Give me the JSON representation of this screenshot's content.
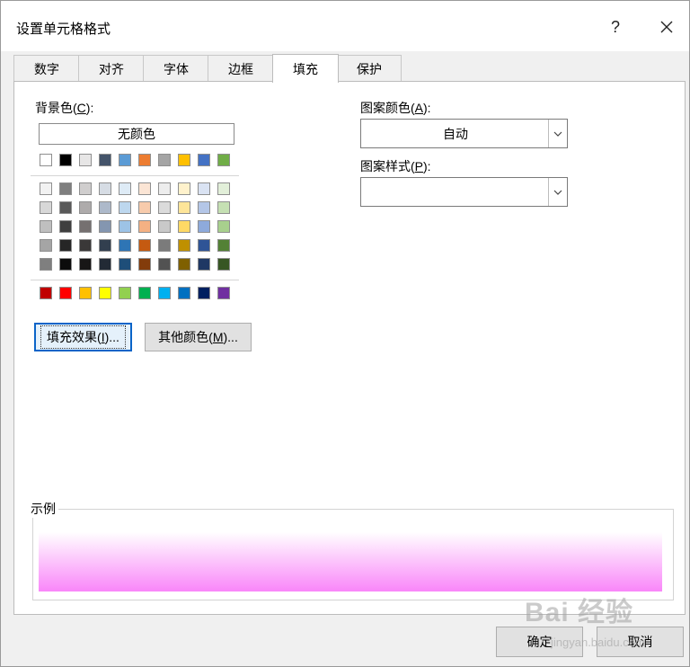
{
  "title": "设置单元格格式",
  "titlebar": {
    "help": "?",
    "close": "✕"
  },
  "tabs": [
    "数字",
    "对齐",
    "字体",
    "边框",
    "填充",
    "保护"
  ],
  "active_tab": "填充",
  "background_color": {
    "label_pre": "背景色(",
    "label_key": "C",
    "label_post": "):",
    "no_color": "无颜色",
    "theme_row": [
      "#ffffff",
      "#000000",
      "#e7e6e6",
      "#44546a",
      "#5b9bd5",
      "#ed7d31",
      "#a5a5a5",
      "#ffc000",
      "#4472c4",
      "#70ad47"
    ],
    "tints": [
      [
        "#f2f2f2",
        "#7f7f7f",
        "#d0cece",
        "#d6dce4",
        "#deebf6",
        "#fbe5d5",
        "#ededed",
        "#fff2cc",
        "#dae3f3",
        "#e2efd9"
      ],
      [
        "#d8d8d8",
        "#595959",
        "#aeabab",
        "#adb9ca",
        "#bdd7ee",
        "#f7cbac",
        "#dbdbdb",
        "#fee599",
        "#b4c6e7",
        "#c5e0b3"
      ],
      [
        "#bfbfbf",
        "#3f3f3f",
        "#757070",
        "#8496b0",
        "#9dc3e6",
        "#f4b183",
        "#c9c9c9",
        "#ffd965",
        "#8eaadb",
        "#a8d08d"
      ],
      [
        "#a5a5a5",
        "#262626",
        "#3a3838",
        "#323f4f",
        "#2e75b5",
        "#c55a11",
        "#7b7b7b",
        "#bf9000",
        "#2f5496",
        "#538135"
      ],
      [
        "#7f7f7f",
        "#0c0c0c",
        "#171616",
        "#222a35",
        "#1e4e79",
        "#833c0b",
        "#525252",
        "#7f6000",
        "#1f3864",
        "#375623"
      ]
    ],
    "standard_row": [
      "#c00000",
      "#ff0000",
      "#ffc000",
      "#ffff00",
      "#92d050",
      "#00b050",
      "#00b0f0",
      "#0070c0",
      "#002060",
      "#7030a0"
    ]
  },
  "buttons": {
    "fill_effects": {
      "pre": "填充效果(",
      "key": "I",
      "post": ")..."
    },
    "more_colors": {
      "pre": "其他颜色(",
      "key": "M",
      "post": ")..."
    }
  },
  "pattern_color": {
    "label_pre": "图案颜色(",
    "label_key": "A",
    "label_post": "):",
    "value": "自动"
  },
  "pattern_style": {
    "label_pre": "图案样式(",
    "label_key": "P",
    "label_post": "):",
    "value": ""
  },
  "sample": {
    "label": "示例",
    "gradient": [
      "#ffffff",
      "#f986f9"
    ]
  },
  "footer": {
    "ok": "确定",
    "cancel": "取消"
  },
  "watermark": {
    "text": "Bai 经验",
    "sub": "jingyan.baidu.com"
  }
}
